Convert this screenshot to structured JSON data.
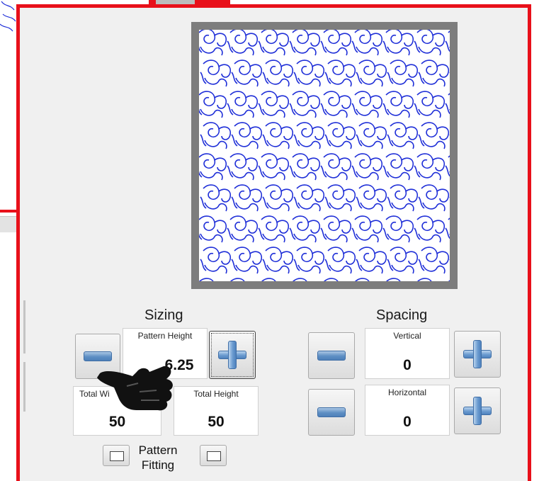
{
  "colors": {
    "highlight_border": "#e8101a",
    "pattern_stroke": "#1f2fd8",
    "icon_blue": "#5e8fc4"
  },
  "preview": {
    "pattern_icon": "tiled-floral-quilt-pattern"
  },
  "sizing": {
    "title": "Sizing",
    "pattern_height": {
      "label": "Pattern Height",
      "value": "6.25"
    },
    "total_width": {
      "label": "Total Wi",
      "value": "50"
    },
    "total_height": {
      "label": "Total Height",
      "value": "50"
    }
  },
  "spacing": {
    "title": "Spacing",
    "vertical": {
      "label": "Vertical",
      "value": "0"
    },
    "horizontal": {
      "label": "Horizontal",
      "value": "0"
    }
  },
  "pattern_fitting": {
    "line1": "Pattern",
    "line2": "Fitting"
  },
  "icons": {
    "minus": "minus-icon",
    "plus": "plus-icon",
    "cursor": "pointing-hand-cursor-icon"
  }
}
